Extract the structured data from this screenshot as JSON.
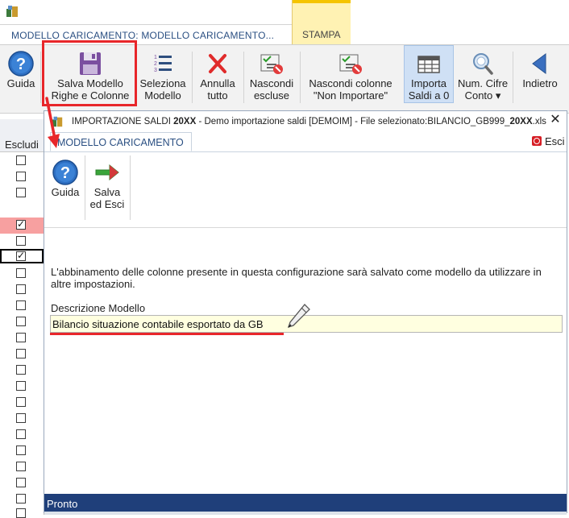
{
  "app": {
    "main_tab": "MODELLO CARICAMENTO: MODELLO CARICAMENTO...",
    "print_tab": "STAMPA"
  },
  "ribbon": {
    "buttons": [
      {
        "label_1": "Guida",
        "label_2": "",
        "icon": "help-icon"
      },
      {
        "label_1": "Salva Modello",
        "label_2": "Righe e Colonne",
        "icon": "floppy-disk-icon"
      },
      {
        "label_1": "Seleziona",
        "label_2": "Modello",
        "icon": "numbered-list-icon"
      },
      {
        "label_1": "Annulla",
        "label_2": "tutto",
        "icon": "red-x-icon"
      },
      {
        "label_1": "Nascondi",
        "label_2": "escluse",
        "icon": "hide-checklist-icon"
      },
      {
        "label_1": "Nascondi colonne",
        "label_2": "\"Non Importare\"",
        "icon": "hide-columns-icon"
      },
      {
        "label_1": "Importa",
        "label_2": "Saldi a 0",
        "icon": "table-grid-icon"
      },
      {
        "label_1": "Num. Cifre",
        "label_2": "Conto ▾",
        "icon": "magnifier-icon"
      },
      {
        "label_1": "Indietro",
        "label_2": "",
        "icon": "back-arrow-icon"
      }
    ]
  },
  "left_panel": {
    "header": "Escludi",
    "rows": [
      false,
      false,
      false,
      true,
      false,
      true,
      false,
      false,
      false,
      false,
      false,
      false,
      false,
      false,
      false,
      false,
      false,
      false,
      false,
      false,
      false,
      false
    ]
  },
  "dialog": {
    "title_prefix": "IMPORTAZIONE SALDI ",
    "title_year": "20XX",
    "title_mid": " - Demo importazione saldi [DEMOIM] - File selezionato:BILANCIO_GB999_",
    "title_year2": "20XX",
    "title_ext": ".xls",
    "close": "✕",
    "tab": "MODELLO CARICAMENTO",
    "esci": "Esci",
    "buttons": [
      {
        "label_1": "Guida",
        "label_2": "",
        "icon": "help-icon"
      },
      {
        "label_1": "Salva",
        "label_2": "ed Esci",
        "icon": "save-exit-arrow-icon"
      }
    ],
    "info_text": "L'abbinamento delle colonne presente in questa configurazione sarà salvato come modello da utilizzare in altre impostazioni.",
    "field_label": "Descrizione Modello",
    "field_value": "Bilancio situazione contabile esportato da GB",
    "status": "Pronto"
  },
  "colors": {
    "accent_red": "#e8262a",
    "status_bar": "#1f3f7a",
    "tab_text": "#2a4f82",
    "stampa_bg": "#fff2b3",
    "input_bg": "#ffffe0"
  }
}
